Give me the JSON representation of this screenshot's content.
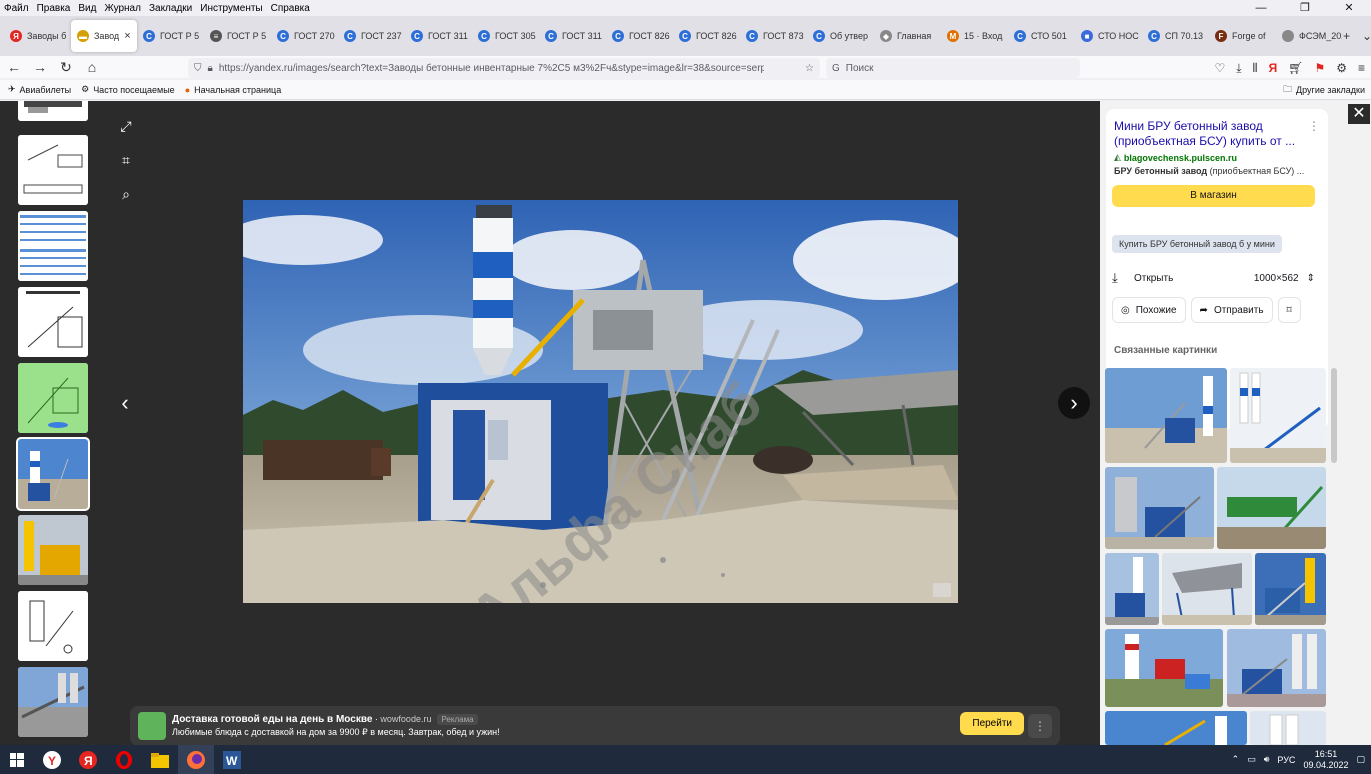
{
  "menu": [
    "Файл",
    "Правка",
    "Вид",
    "Журнал",
    "Закладки",
    "Инструменты",
    "Справка"
  ],
  "tabs": [
    {
      "label": "Заводы б",
      "fav": "#e52620",
      "glyph": "Я"
    },
    {
      "label": "Завод",
      "fav": "#d4a000",
      "glyph": "▬",
      "active": true
    },
    {
      "label": "ГОСТ Р 5",
      "fav": "#2e6fd6",
      "glyph": "C"
    },
    {
      "label": "ГОСТ Р 5",
      "fav": "#555",
      "glyph": "≡"
    },
    {
      "label": "ГОСТ 270",
      "fav": "#2e6fd6",
      "glyph": "C"
    },
    {
      "label": "ГОСТ 237",
      "fav": "#2e6fd6",
      "glyph": "C"
    },
    {
      "label": "ГОСТ 311",
      "fav": "#2e6fd6",
      "glyph": "C"
    },
    {
      "label": "ГОСТ 305",
      "fav": "#2e6fd6",
      "glyph": "C"
    },
    {
      "label": "ГОСТ 311",
      "fav": "#2e6fd6",
      "glyph": "C"
    },
    {
      "label": "ГОСТ 826",
      "fav": "#2e6fd6",
      "glyph": "C"
    },
    {
      "label": "ГОСТ 826",
      "fav": "#2e6fd6",
      "glyph": "C"
    },
    {
      "label": "ГОСТ 873",
      "fav": "#2e6fd6",
      "glyph": "C"
    },
    {
      "label": "Об утвер",
      "fav": "#2e6fd6",
      "glyph": "C"
    },
    {
      "label": "Главная",
      "fav": "#888",
      "glyph": "◆"
    },
    {
      "label": "15 · Вход",
      "fav": "#e07000",
      "glyph": "M"
    },
    {
      "label": "СТО 501",
      "fav": "#2e6fd6",
      "glyph": "C"
    },
    {
      "label": "СТО НОС",
      "fav": "#3a6bd8",
      "glyph": "■"
    },
    {
      "label": "СП 70.13",
      "fav": "#2e6fd6",
      "glyph": "C"
    },
    {
      "label": "Forge of",
      "fav": "#7a2d12",
      "glyph": "F"
    },
    {
      "label": "ФСЭМ_2020_",
      "fav": "#888",
      "glyph": ""
    }
  ],
  "tab_close": "×",
  "window": {
    "minimize": "—",
    "maximize": "❐",
    "close": "✕"
  },
  "url": "https://yandex.ru/images/search?text=Заводы бетонные инвентарные 7%2С5 м3%2Fч&stype=image&lr=38&source=serp",
  "search_placeholder": "Поиск",
  "bookmarks": [
    "Авиабилеты",
    "Часто посещаемые",
    "Начальная страница"
  ],
  "other_bookmarks": "Другие закладки",
  "ad": {
    "title": "Доставка готовой еды на день в Москве",
    "source": "wowfoode.ru",
    "label": "Реклама",
    "text": "Любимые блюда с доставкой на дом за 9900 ₽ в месяц. Завтрак, обед и ужин!",
    "button": "Перейти"
  },
  "watermark": "Альфа Снаб",
  "panel": {
    "title": "Мини БРУ бетонный завод (приобъектная БСУ) купить от ...",
    "domain": "blagovechensk.pulscen.ru",
    "desc_bold": "БРУ бетонный завод",
    "desc_rest": " (приобъектная БСУ) ...",
    "shop": "В магазин",
    "tag": "Купить БРУ бетонный завод б у мини",
    "open": "Открыть",
    "size": "1000×562",
    "similar": "Похожие",
    "send": "Отправить",
    "related": "Связанные картинки"
  },
  "clock": {
    "time": "16:51",
    "date": "09.04.2022"
  },
  "lang": "РУС",
  "colors": {
    "accent": "#ffdb4d",
    "link": "#1a0dab",
    "domain": "#007700",
    "viewer_bg": "#2b2b2b"
  }
}
